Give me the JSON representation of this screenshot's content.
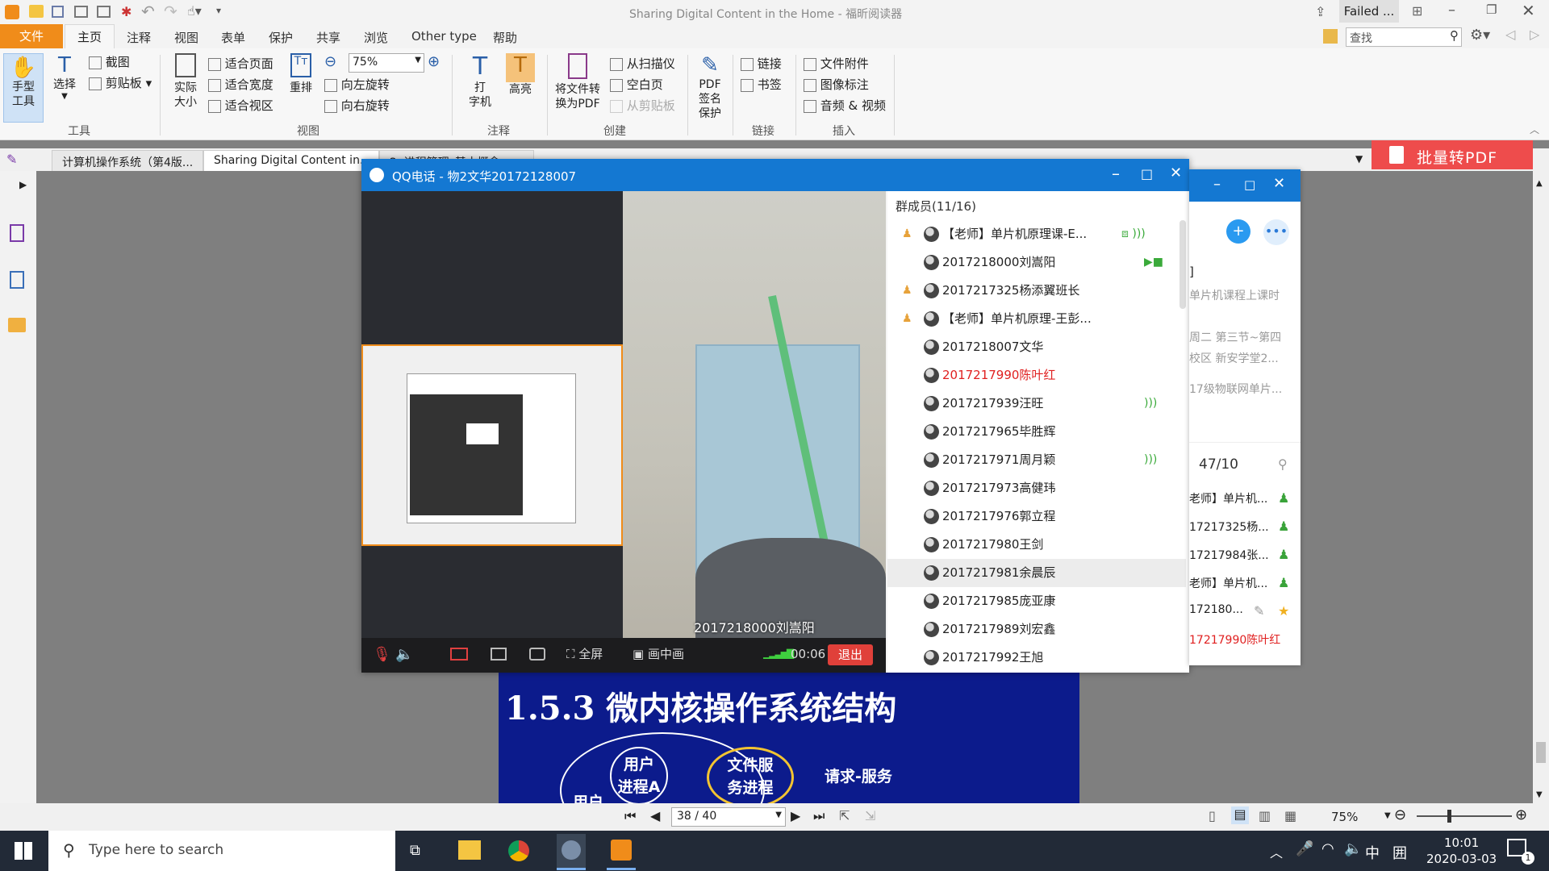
{
  "window": {
    "title": "Sharing Digital Content in the Home - 福昕阅读器",
    "account_status": "Failed ..."
  },
  "ribbon_tabs": [
    "文件",
    "主页",
    "注释",
    "视图",
    "表单",
    "保护",
    "共享",
    "浏览",
    "Other type",
    "帮助"
  ],
  "search": {
    "placeholder": "查找"
  },
  "ribbon": {
    "hand_tool": "手型\n工具",
    "select": "选择",
    "screenshot": "截图",
    "clipboard": "剪贴板",
    "tools_group": "工具",
    "actual_size": "实际\n大小",
    "fit_page": "适合页面",
    "fit_width": "适合宽度",
    "fit_visible": "适合视区",
    "reflow": "重排",
    "zoom_value": "75%",
    "rotate_left": "向左旋转",
    "rotate_right": "向右旋转",
    "view_group": "视图",
    "typewriter": "打\n字机",
    "highlight": "高亮",
    "annot_group": "注释",
    "convert_pdf": "将文件转\n换为PDF",
    "from_scanner": "从扫描仪",
    "blank_page": "空白页",
    "from_clipboard": "从剪贴板",
    "create_group": "创建",
    "pdf_sign": "PDF\n签名\n保护",
    "link": "链接",
    "bookmark": "书签",
    "link_group": "链接",
    "file_attach": "文件附件",
    "image_annot": "图像标注",
    "audio_video": "音频 & 视频",
    "insert_group": "插入"
  },
  "doc_tabs": [
    "计算机操作系统（第4版...",
    "Sharing Digital Content in...",
    "2. 进程管理_基本概念..."
  ],
  "batch_pdf": "批量转PDF",
  "slide": {
    "title": "1.5.3 微内核操作系统结构",
    "bubble1": "用户\n进程A",
    "bubble2": "文件服\n务进程",
    "label": "请求-服务",
    "bubble3": "用户"
  },
  "qq": {
    "title": "QQ电话 - 物2文华20172128007",
    "video_caption": "2017218000刘嵩阳",
    "members_header": "群成员(11/16)",
    "fullscreen": "全屏",
    "pip": "画中画",
    "timer": "00:06",
    "exit": "退出",
    "members": [
      {
        "name": "【老师】单片机原理课-E...",
        "host": true,
        "status": "screen",
        "color": "#222222"
      },
      {
        "name": "2017218000刘嵩阳",
        "host": false,
        "status": "video",
        "color": "#222222"
      },
      {
        "name": "2017217325杨添翼班长",
        "host": true,
        "status": "",
        "color": "#222222"
      },
      {
        "name": "【老师】单片机原理-王彭...",
        "host": true,
        "status": "",
        "color": "#222222"
      },
      {
        "name": "2017218007文华",
        "host": false,
        "status": "",
        "color": "#222222"
      },
      {
        "name": "2017217990陈叶红",
        "host": false,
        "status": "",
        "color": "#e02020"
      },
      {
        "name": "2017217939汪旺",
        "host": false,
        "status": "voice",
        "color": "#222222"
      },
      {
        "name": "2017217965毕胜辉",
        "host": false,
        "status": "",
        "color": "#222222"
      },
      {
        "name": "2017217971周月颖",
        "host": false,
        "status": "voice",
        "color": "#222222"
      },
      {
        "name": "2017217973高健玮",
        "host": false,
        "status": "",
        "color": "#222222"
      },
      {
        "name": "2017217976郭立程",
        "host": false,
        "status": "",
        "color": "#222222"
      },
      {
        "name": "2017217980王剑",
        "host": false,
        "status": "",
        "color": "#222222"
      },
      {
        "name": "2017217981余晨辰",
        "host": false,
        "status": "",
        "color": "#222222"
      },
      {
        "name": "2017217985庞亚康",
        "host": false,
        "status": "",
        "color": "#222222"
      },
      {
        "name": "2017217989刘宏鑫",
        "host": false,
        "status": "",
        "color": "#222222"
      },
      {
        "name": "2017217992王旭",
        "host": false,
        "status": "",
        "color": "#222222"
      }
    ]
  },
  "qq_side": {
    "bracket": "]",
    "course": "单片机课程上课时",
    "schedule1": "周二 第三节~第四",
    "schedule2": "校区 新安学堂2...",
    "group": "17级物联网单片...",
    "count": "47/10",
    "rows": [
      "老师】单片机...",
      "17217325杨...",
      "17217984张...",
      "老师】单片机...",
      "172180..."
    ],
    "last_row": "17217990陈叶红"
  },
  "status": {
    "page": "38 / 40",
    "zoom": "75%"
  },
  "taskbar": {
    "search_placeholder": "Type here to search",
    "time": "10:01",
    "date": "2020-03-03",
    "ime1": "中",
    "ime2": "囲",
    "notifications": "1"
  }
}
